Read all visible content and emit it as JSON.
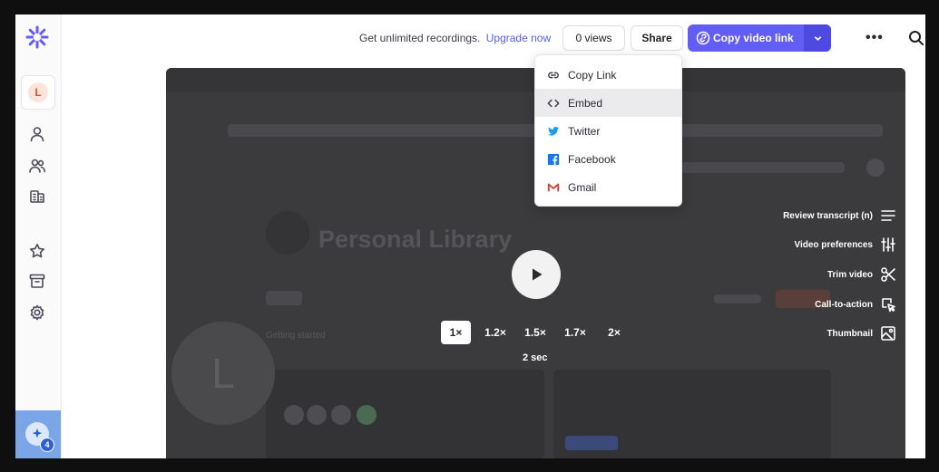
{
  "sidebar": {
    "avatar_initial": "L",
    "notification_count": "4"
  },
  "header": {
    "promo_text": "Get unlimited recordings.",
    "upgrade_link": "Upgrade now",
    "views_label": "0 views",
    "share_label": "Share",
    "copy_link_label": "Copy video link"
  },
  "share_menu": {
    "items": [
      {
        "label": "Copy Link",
        "icon": "link-icon"
      },
      {
        "label": "Embed",
        "icon": "code-icon"
      },
      {
        "label": "Twitter",
        "icon": "twitter-icon"
      },
      {
        "label": "Facebook",
        "icon": "facebook-icon"
      },
      {
        "label": "Gmail",
        "icon": "gmail-icon"
      }
    ]
  },
  "video": {
    "background_title": "Personal Library",
    "background_section": "Getting started",
    "background_avatar": "L",
    "speeds": [
      "1×",
      "1.2×",
      "1.5×",
      "1.7×",
      "2×"
    ],
    "active_speed": "1×",
    "skip_label": "2 sec",
    "actions": [
      {
        "label": "Review transcript (n)",
        "icon": "transcript-icon"
      },
      {
        "label": "Video preferences",
        "icon": "sliders-icon"
      },
      {
        "label": "Trim video",
        "icon": "scissors-icon"
      },
      {
        "label": "Call-to-action",
        "icon": "cursor-icon"
      },
      {
        "label": "Thumbnail",
        "icon": "image-icon"
      }
    ]
  },
  "colors": {
    "accent": "#625df5",
    "accent_dark": "#4f49e3",
    "link": "#5b5ee8"
  }
}
